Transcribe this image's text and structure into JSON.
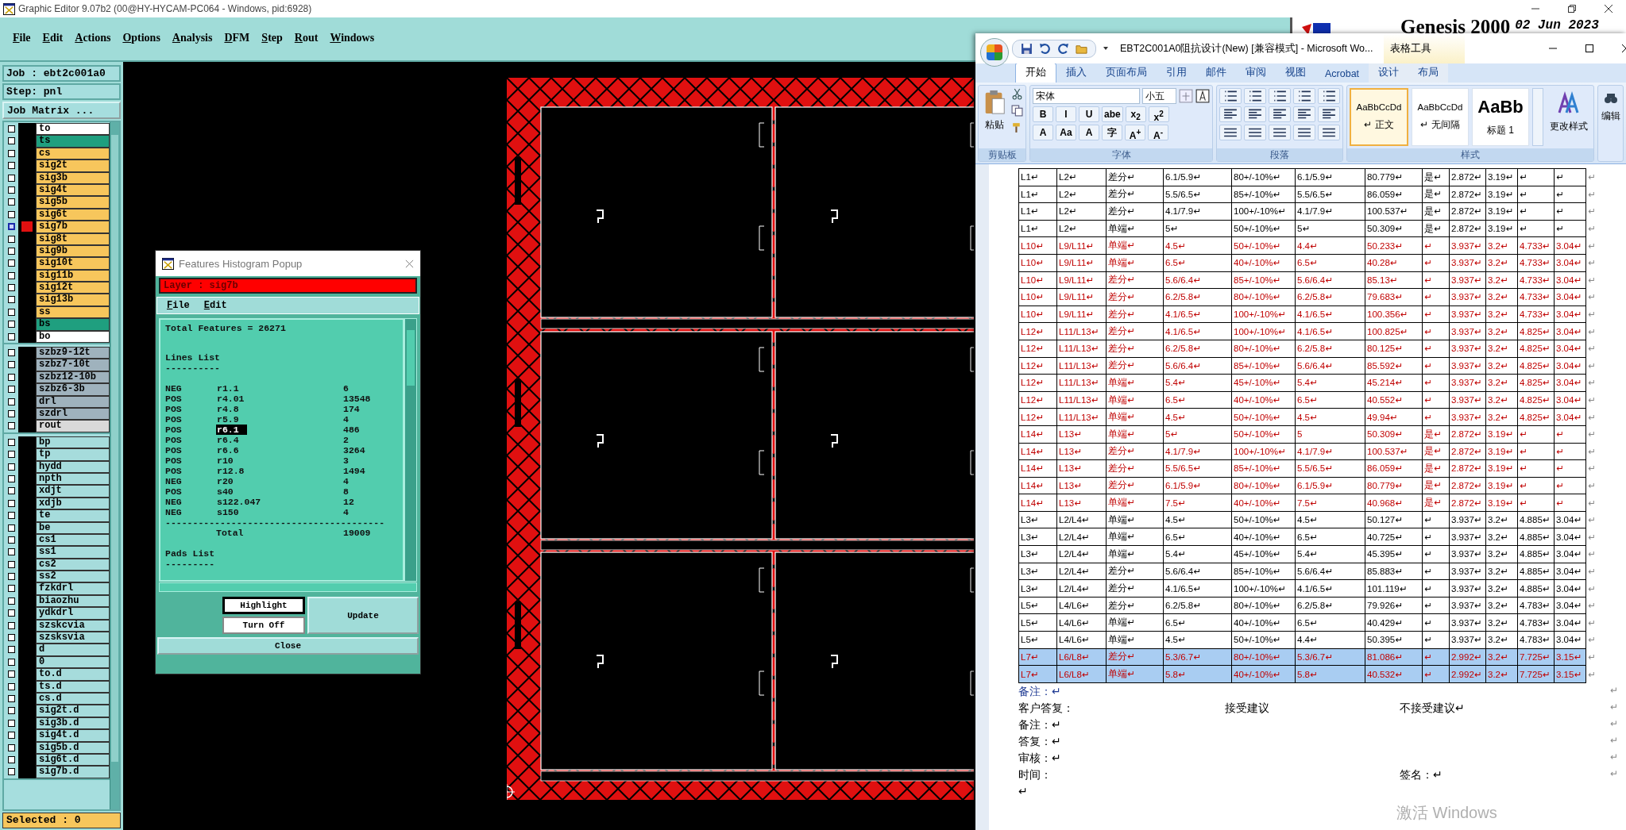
{
  "graphic_editor": {
    "title": "Graphic Editor 9.07b2 (00@HY-HYCAM-PC064 - Windows, pid:6928)",
    "menu": [
      "File",
      "Edit",
      "Actions",
      "Options",
      "Analysis",
      "DFM",
      "Step",
      "Rout",
      "Windows"
    ],
    "header": {
      "product": "Genesis 2000",
      "date": "02 Jun 2023"
    },
    "job": "Job : ebt2c001a0",
    "step": "Step: pnl",
    "job_matrix_button": "Job Matrix ...",
    "layer_groups": [
      {
        "layers": [
          {
            "name": "to",
            "color": "#ffffff",
            "selected": false
          },
          {
            "name": "ts",
            "color": "#1f9f7f",
            "selected": false
          },
          {
            "name": "cs",
            "color": "#f7c65c",
            "selected": false
          },
          {
            "name": "sig2t",
            "color": "#f7c65c",
            "selected": false
          },
          {
            "name": "sig3b",
            "color": "#f7c65c",
            "selected": false
          },
          {
            "name": "sig4t",
            "color": "#f7c65c",
            "selected": false
          },
          {
            "name": "sig5b",
            "color": "#f7c65c",
            "selected": false
          },
          {
            "name": "sig6t",
            "color": "#f7c65c",
            "selected": false
          },
          {
            "name": "sig7b",
            "color": "#f7c65c",
            "selected": true
          },
          {
            "name": "sig8t",
            "color": "#f7c65c",
            "selected": false
          },
          {
            "name": "sig9b",
            "color": "#f7c65c",
            "selected": false
          },
          {
            "name": "sig10t",
            "color": "#f7c65c",
            "selected": false
          },
          {
            "name": "sig11b",
            "color": "#f7c65c",
            "selected": false
          },
          {
            "name": "sig12t",
            "color": "#f7c65c",
            "selected": false
          },
          {
            "name": "sig13b",
            "color": "#f7c65c",
            "selected": false
          },
          {
            "name": "ss",
            "color": "#f7c65c",
            "selected": false
          },
          {
            "name": "bs",
            "color": "#1f9f7f",
            "selected": false
          },
          {
            "name": "bo",
            "color": "#ffffff",
            "selected": false
          }
        ]
      },
      {
        "layers": [
          {
            "name": "szbz9-12t",
            "color": "#9fb2bd",
            "selected": false
          },
          {
            "name": "szbz7-10t",
            "color": "#9fb2bd",
            "selected": false
          },
          {
            "name": "szbz12-10b",
            "color": "#9fb2bd",
            "selected": false
          },
          {
            "name": "szbz6-3b",
            "color": "#9fb2bd",
            "selected": false
          },
          {
            "name": "drl",
            "color": "#9fb2bd",
            "selected": false
          },
          {
            "name": "szdrl",
            "color": "#9fb2bd",
            "selected": false
          },
          {
            "name": "rout",
            "color": "#d9d9d9",
            "selected": false
          }
        ]
      },
      {
        "layers": [
          {
            "name": "bp",
            "color": "#a6dcdc",
            "selected": false
          },
          {
            "name": "tp",
            "color": "#a6dcdc",
            "selected": false
          },
          {
            "name": "hydd",
            "color": "#a6dcdc",
            "selected": false
          },
          {
            "name": "npth",
            "color": "#a6dcdc",
            "selected": false
          },
          {
            "name": "xdjt",
            "color": "#a6dcdc",
            "selected": false
          },
          {
            "name": "xdjb",
            "color": "#a6dcdc",
            "selected": false
          },
          {
            "name": "te",
            "color": "#a6dcdc",
            "selected": false
          },
          {
            "name": "be",
            "color": "#a6dcdc",
            "selected": false
          },
          {
            "name": "cs1",
            "color": "#a6dcdc",
            "selected": false
          },
          {
            "name": "ss1",
            "color": "#a6dcdc",
            "selected": false
          },
          {
            "name": "cs2",
            "color": "#a6dcdc",
            "selected": false
          },
          {
            "name": "ss2",
            "color": "#a6dcdc",
            "selected": false
          },
          {
            "name": "fzkdrl",
            "color": "#a6dcdc",
            "selected": false
          },
          {
            "name": "biaozhu",
            "color": "#a6dcdc",
            "selected": false
          },
          {
            "name": "ydkdrl",
            "color": "#a6dcdc",
            "selected": false
          },
          {
            "name": "szskcvia",
            "color": "#a6dcdc",
            "selected": false
          },
          {
            "name": "szsksvia",
            "color": "#a6dcdc",
            "selected": false
          },
          {
            "name": "d",
            "color": "#a6dcdc",
            "selected": false
          },
          {
            "name": "0",
            "color": "#a6dcdc",
            "selected": false
          },
          {
            "name": "to.d",
            "color": "#a6dcdc",
            "selected": false
          },
          {
            "name": "ts.d",
            "color": "#a6dcdc",
            "selected": false
          },
          {
            "name": "cs.d",
            "color": "#a6dcdc",
            "selected": false
          },
          {
            "name": "sig2t.d",
            "color": "#a6dcdc",
            "selected": false
          },
          {
            "name": "sig3b.d",
            "color": "#a6dcdc",
            "selected": false
          },
          {
            "name": "sig4t.d",
            "color": "#a6dcdc",
            "selected": false
          },
          {
            "name": "sig5b.d",
            "color": "#a6dcdc",
            "selected": false
          },
          {
            "name": "sig6t.d",
            "color": "#a6dcdc",
            "selected": false
          },
          {
            "name": "sig7b.d",
            "color": "#a6dcdc",
            "selected": false
          }
        ]
      }
    ],
    "status": "Selected : 0"
  },
  "histogram_popup": {
    "title": "Features Histogram Popup",
    "layer": "Layer :  sig7b",
    "menu": [
      "File",
      "Edit"
    ],
    "total_features": "Total Features = 26271",
    "lines_heading": "Lines List",
    "lines_rule": "----------",
    "lines": [
      {
        "polarity": "NEG",
        "symbol": "r1.1",
        "count": "6",
        "selected": false
      },
      {
        "polarity": "POS",
        "symbol": "r4.01",
        "count": "13548",
        "selected": false
      },
      {
        "polarity": "POS",
        "symbol": "r4.8",
        "count": "174",
        "selected": false
      },
      {
        "polarity": "POS",
        "symbol": "r5.9",
        "count": "4",
        "selected": false
      },
      {
        "polarity": "POS",
        "symbol": "r6.1",
        "count": "486",
        "selected": true
      },
      {
        "polarity": "POS",
        "symbol": "r6.4",
        "count": "2",
        "selected": false
      },
      {
        "polarity": "POS",
        "symbol": "r6.6",
        "count": "3264",
        "selected": false
      },
      {
        "polarity": "POS",
        "symbol": "r10",
        "count": "3",
        "selected": false
      },
      {
        "polarity": "POS",
        "symbol": "r12.8",
        "count": "1494",
        "selected": false
      },
      {
        "polarity": "NEG",
        "symbol": "r20",
        "count": "4",
        "selected": false
      },
      {
        "polarity": "POS",
        "symbol": "s40",
        "count": "8",
        "selected": false
      },
      {
        "polarity": "NEG",
        "symbol": "s122.047",
        "count": "12",
        "selected": false
      },
      {
        "polarity": "NEG",
        "symbol": "s150",
        "count": "4",
        "selected": false
      }
    ],
    "total_rule": "----------------------------------------",
    "total_label": "Total",
    "total": "19009",
    "pads_heading": "Pads List",
    "pads_rule": "---------",
    "buttons": {
      "highlight": "Highlight",
      "turn_off": "Turn Off",
      "update": "Update",
      "close": "Close"
    }
  },
  "word_window": {
    "title": "EBT2C001A0阻抗设计(New) [兼容模式] - Microsoft Wo...",
    "context_label": "表格工具",
    "tabs": [
      {
        "label": "开始",
        "selected": true,
        "context": false
      },
      {
        "label": "插入",
        "selected": false,
        "context": false
      },
      {
        "label": "页面布局",
        "selected": false,
        "context": false
      },
      {
        "label": "引用",
        "selected": false,
        "context": false
      },
      {
        "label": "邮件",
        "selected": false,
        "context": false
      },
      {
        "label": "审阅",
        "selected": false,
        "context": false
      },
      {
        "label": "视图",
        "selected": false,
        "context": false
      },
      {
        "label": "Acrobat",
        "selected": false,
        "context": false
      },
      {
        "label": "设计",
        "selected": false,
        "context": true
      },
      {
        "label": "布局",
        "selected": false,
        "context": true
      }
    ],
    "ribbon": {
      "clipboard": {
        "label": "剪贴板",
        "paste": "粘贴"
      },
      "font": {
        "label": "字体",
        "face": "宋体",
        "size": "小五",
        "row2": [
          "B",
          "I",
          "U",
          "abe",
          "x$_{2}$",
          "x$^{2}$"
        ],
        "row3": [
          "A",
          "Aa",
          "A",
          "字",
          "A$^{+}$",
          "A$^{-}$"
        ]
      },
      "paragraph": {
        "label": "段落"
      },
      "styles": {
        "label": "样式",
        "items": [
          {
            "sample": "AaBbCcDd",
            "name": "↵ 正文",
            "selected": true
          },
          {
            "sample": "AaBbCcDd",
            "name": "↵ 无间隔",
            "selected": false
          },
          {
            "sample": "AaBb",
            "name": "标题 1",
            "selected": false
          }
        ],
        "change": "更改样式"
      },
      "editing": {
        "label": "编辑"
      }
    },
    "table": {
      "rows": [
        {
          "kind": "plain",
          "selected": false,
          "end": "↵",
          "cells": [
            "L1↵",
            "L2↵",
            "差分↵",
            "6.1/5.9↵",
            "80+/-10%↵",
            "6.1/5.9↵",
            "80.779↵",
            "是↵",
            "2.872↵",
            "3.19↵",
            "↵",
            "↵"
          ]
        },
        {
          "kind": "plain",
          "selected": false,
          "end": "↵",
          "cells": [
            "L1↵",
            "L2↵",
            "差分↵",
            "5.5/6.5↵",
            "85+/-10%↵",
            "5.5/6.5↵",
            "86.059↵",
            "是↵",
            "2.872↵",
            "3.19↵",
            "↵",
            "↵"
          ]
        },
        {
          "kind": "plain",
          "selected": false,
          "end": "↵",
          "cells": [
            "L1↵",
            "L2↵",
            "差分↵",
            "4.1/7.9↵",
            "100+/-10%↵",
            "4.1/7.9↵",
            "100.537↵",
            "是↵",
            "2.872↵",
            "3.19↵",
            "↵",
            "↵"
          ]
        },
        {
          "kind": "plain",
          "selected": false,
          "end": "↵",
          "cells": [
            "L1↵",
            "L2↵",
            "单端↵",
            "5↵",
            "50+/-10%↵",
            "5↵",
            "50.309↵",
            "是↵",
            "2.872↵",
            "3.19↵",
            "↵",
            "↵"
          ]
        },
        {
          "kind": "changed",
          "selected": false,
          "end": "↵",
          "cells": [
            "L10↵",
            "L9/L11↵",
            "单端↵",
            "4.5↵",
            "50+/-10%↵",
            "4.4↵",
            "50.233↵",
            "↵",
            "3.937↵",
            "3.2↵",
            "4.733↵",
            "3.04↵"
          ]
        },
        {
          "kind": "changed",
          "selected": false,
          "end": "↵",
          "cells": [
            "L10↵",
            "L9/L11↵",
            "单端↵",
            "6.5↵",
            "40+/-10%↵",
            "6.5↵",
            "40.28↵",
            "↵",
            "3.937↵",
            "3.2↵",
            "4.733↵",
            "3.04↵"
          ]
        },
        {
          "kind": "changed",
          "selected": false,
          "end": "↵",
          "cells": [
            "L10↵",
            "L9/L11↵",
            "差分↵",
            "5.6/6.4↵",
            "85+/-10%↵",
            "5.6/6.4↵",
            "85.13↵",
            "↵",
            "3.937↵",
            "3.2↵",
            "4.733↵",
            "3.04↵"
          ]
        },
        {
          "kind": "changed",
          "selected": false,
          "end": "↵",
          "cells": [
            "L10↵",
            "L9/L11↵",
            "差分↵",
            "6.2/5.8↵",
            "80+/-10%↵",
            "6.2/5.8↵",
            "79.683↵",
            "↵",
            "3.937↵",
            "3.2↵",
            "4.733↵",
            "3.04↵"
          ]
        },
        {
          "kind": "changed",
          "selected": false,
          "end": "↵",
          "cells": [
            "L10↵",
            "L9/L11↵",
            "差分↵",
            "4.1/6.5↵",
            "100+/-10%↵",
            "4.1/6.5↵",
            "100.356↵",
            "↵",
            "3.937↵",
            "3.2↵",
            "4.733↵",
            "3.04↵"
          ]
        },
        {
          "kind": "changed",
          "selected": false,
          "end": "↵",
          "cells": [
            "L12↵",
            "L11/L13↵",
            "差分↵",
            "4.1/6.5↵",
            "100+/-10%↵",
            "4.1/6.5↵",
            "100.825↵",
            "↵",
            "3.937↵",
            "3.2↵",
            "4.825↵",
            "3.04↵"
          ]
        },
        {
          "kind": "changed",
          "selected": false,
          "end": "↵",
          "cells": [
            "L12↵",
            "L11/L13↵",
            "差分↵",
            "6.2/5.8↵",
            "80+/-10%↵",
            "6.2/5.8↵",
            "80.125↵",
            "↵",
            "3.937↵",
            "3.2↵",
            "4.825↵",
            "3.04↵"
          ]
        },
        {
          "kind": "changed",
          "selected": false,
          "end": "↵",
          "cells": [
            "L12↵",
            "L11/L13↵",
            "差分↵",
            "5.6/6.4↵",
            "85+/-10%↵",
            "5.6/6.4↵",
            "85.592↵",
            "↵",
            "3.937↵",
            "3.2↵",
            "4.825↵",
            "3.04↵"
          ]
        },
        {
          "kind": "changed",
          "selected": false,
          "end": "↵",
          "cells": [
            "L12↵",
            "L11/L13↵",
            "单端↵",
            "5.4↵",
            "45+/-10%↵",
            "5.4↵",
            "45.214↵",
            "↵",
            "3.937↵",
            "3.2↵",
            "4.825↵",
            "3.04↵"
          ]
        },
        {
          "kind": "changed",
          "selected": false,
          "end": "↵",
          "cells": [
            "L12↵",
            "L11/L13↵",
            "单端↵",
            "6.5↵",
            "40+/-10%↵",
            "6.5↵",
            "40.552↵",
            "↵",
            "3.937↵",
            "3.2↵",
            "4.825↵",
            "3.04↵"
          ]
        },
        {
          "kind": "changed",
          "selected": false,
          "end": "↵",
          "cells": [
            "L12↵",
            "L11/L13↵",
            "单端↵",
            "4.5↵",
            "50+/-10%↵",
            "4.5↵",
            "49.94↵",
            "↵",
            "3.937↵",
            "3.2↵",
            "4.825↵",
            "3.04↵"
          ]
        },
        {
          "kind": "changed",
          "selected": false,
          "end": "↵",
          "cells": [
            "L14↵",
            "L13↵",
            "单端↵",
            "5↵",
            "50+/-10%↵",
            "5",
            "50.309↵",
            "是↵",
            "2.872↵",
            "3.19↵",
            "↵",
            "↵"
          ]
        },
        {
          "kind": "changed",
          "selected": false,
          "end": "↵",
          "cells": [
            "L14↵",
            "L13↵",
            "差分↵",
            "4.1/7.9↵",
            "100+/-10%↵",
            "4.1/7.9↵",
            "100.537↵",
            "是↵",
            "2.872↵",
            "3.19↵",
            "↵",
            "↵"
          ]
        },
        {
          "kind": "changed",
          "selected": false,
          "end": "↵",
          "cells": [
            "L14↵",
            "L13↵",
            "差分↵",
            "5.5/6.5↵",
            "85+/-10%↵",
            "5.5/6.5↵",
            "86.059↵",
            "是↵",
            "2.872↵",
            "3.19↵",
            "↵",
            "↵"
          ]
        },
        {
          "kind": "changed",
          "selected": false,
          "end": "↵",
          "cells": [
            "L14↵",
            "L13↵",
            "差分↵",
            "6.1/5.9↵",
            "80+/-10%↵",
            "6.1/5.9↵",
            "80.779↵",
            "是↵",
            "2.872↵",
            "3.19↵",
            "↵",
            "↵"
          ]
        },
        {
          "kind": "changed",
          "selected": false,
          "end": "↵",
          "cells": [
            "L14↵",
            "L13↵",
            "单端↵",
            "7.5↵",
            "40+/-10%↵",
            "7.5↵",
            "40.968↵",
            "是↵",
            "2.872↵",
            "3.19↵",
            "↵",
            "↵"
          ]
        },
        {
          "kind": "plain",
          "selected": false,
          "end": "↵",
          "cells": [
            "L3↵",
            "L2/L4↵",
            "单端↵",
            "4.5↵",
            "50+/-10%↵",
            "4.5↵",
            "50.127↵",
            "↵",
            "3.937↵",
            "3.2↵",
            "4.885↵",
            "3.04↵"
          ]
        },
        {
          "kind": "plain",
          "selected": false,
          "end": "↵",
          "cells": [
            "L3↵",
            "L2/L4↵",
            "单端↵",
            "6.5↵",
            "40+/-10%↵",
            "6.5↵",
            "40.725↵",
            "↵",
            "3.937↵",
            "3.2↵",
            "4.885↵",
            "3.04↵"
          ]
        },
        {
          "kind": "plain",
          "selected": false,
          "end": "↵",
          "cells": [
            "L3↵",
            "L2/L4↵",
            "单端↵",
            "5.4↵",
            "45+/-10%↵",
            "5.4↵",
            "45.395↵",
            "↵",
            "3.937↵",
            "3.2↵",
            "4.885↵",
            "3.04↵"
          ]
        },
        {
          "kind": "plain",
          "selected": false,
          "end": "↵",
          "cells": [
            "L3↵",
            "L2/L4↵",
            "差分↵",
            "5.6/6.4↵",
            "85+/-10%↵",
            "5.6/6.4↵",
            "85.883↵",
            "↵",
            "3.937↵",
            "3.2↵",
            "4.885↵",
            "3.04↵"
          ]
        },
        {
          "kind": "plain",
          "selected": false,
          "end": "↵",
          "cells": [
            "L3↵",
            "L2/L4↵",
            "差分↵",
            "4.1/6.5↵",
            "100+/-10%↵",
            "4.1/6.5↵",
            "101.119↵",
            "↵",
            "3.937↵",
            "3.2↵",
            "4.885↵",
            "3.04↵"
          ]
        },
        {
          "kind": "plain",
          "selected": false,
          "end": "↵",
          "cells": [
            "L5↵",
            "L4/L6↵",
            "差分↵",
            "6.2/5.8↵",
            "80+/-10%↵",
            "6.2/5.8↵",
            "79.926↵",
            "↵",
            "3.937↵",
            "3.2↵",
            "4.783↵",
            "3.04↵"
          ]
        },
        {
          "kind": "plain",
          "selected": false,
          "end": "↵",
          "cells": [
            "L5↵",
            "L4/L6↵",
            "单端↵",
            "6.5↵",
            "40+/-10%↵",
            "6.5↵",
            "40.429↵",
            "↵",
            "3.937↵",
            "3.2↵",
            "4.783↵",
            "3.04↵"
          ]
        },
        {
          "kind": "plain",
          "selected": false,
          "end": "↵",
          "cells": [
            "L5↵",
            "L4/L6↵",
            "单端↵",
            "4.5↵",
            "50+/-10%↵",
            "4.4↵",
            "50.395↵",
            "↵",
            "3.937↵",
            "3.2↵",
            "4.783↵",
            "3.04↵"
          ]
        },
        {
          "kind": "changed",
          "selected": true,
          "end": "↵",
          "cells": [
            "L7↵",
            "L6/L8↵",
            "差分↵",
            "5.3/6.7↵",
            "80+/-10%↵",
            "5.3/6.7↵",
            "81.086↵",
            "↵",
            "2.992↵",
            "3.2↵",
            "7.725↵",
            "3.15↵"
          ]
        },
        {
          "kind": "changed",
          "selected": true,
          "end": "↵",
          "cells": [
            "L7↵",
            "L6/L8↵",
            "单端↵",
            "5.8↵",
            "40+/-10%↵",
            "5.8↵",
            "40.532↵",
            "↵",
            "2.992↵",
            "3.2↵",
            "7.725↵",
            "3.15↵"
          ]
        }
      ]
    },
    "notes": [
      {
        "color": "#1f3a93",
        "parts": [
          "备注：↵"
        ],
        "end": "↵"
      },
      {
        "color": "#000000",
        "parts": [
          "客户答复：",
          "接受建议",
          "不接受建议↵"
        ],
        "end": "↵"
      },
      {
        "color": "#000000",
        "parts": [
          "备注：↵"
        ],
        "end": "↵"
      },
      {
        "color": "#000000",
        "parts": [
          "答复：↵"
        ],
        "end": "↵"
      },
      {
        "color": "#000000",
        "parts": [
          "审核：↵"
        ],
        "end": "↵"
      },
      {
        "color": "#000000",
        "parts": [
          "时间：",
          "签名：↵"
        ],
        "end": "↵"
      },
      {
        "color": "#000000",
        "parts": [
          "↵"
        ]
      }
    ],
    "activation_notice": "激活 Windows"
  }
}
